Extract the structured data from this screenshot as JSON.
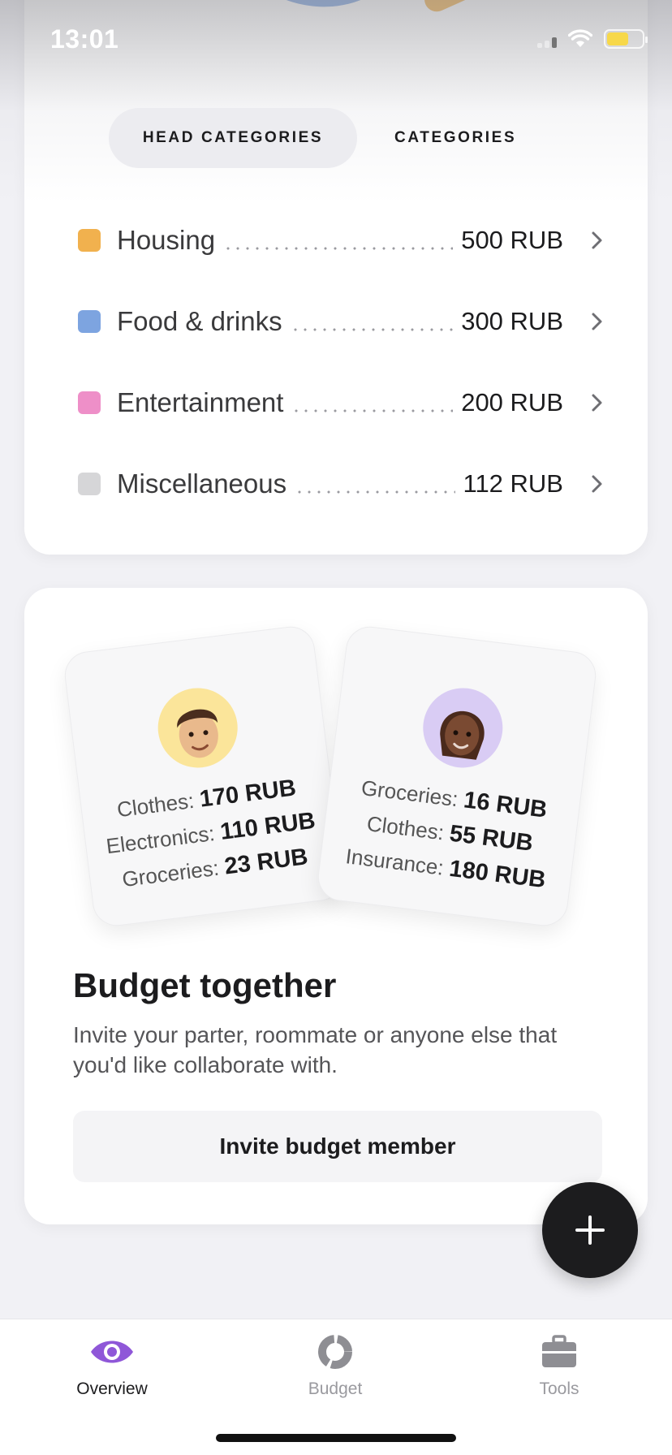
{
  "status_bar": {
    "time": "13:01"
  },
  "segmented": {
    "head_categories": "HEAD CATEGORIES",
    "categories": "CATEGORIES"
  },
  "categories": [
    {
      "name": "Housing",
      "amount": "500 RUB",
      "color": "#f1b14e"
    },
    {
      "name": "Food & drinks",
      "amount": "300 RUB",
      "color": "#7da4e0"
    },
    {
      "name": "Entertainment",
      "amount": "200 RUB",
      "color": "#ee8fc8"
    },
    {
      "name": "Miscellaneous",
      "amount": "112 RUB",
      "color": "#d6d6d8"
    }
  ],
  "budget_together": {
    "member1": {
      "lines": [
        {
          "label": "Clothes:",
          "value": "170 RUB"
        },
        {
          "label": "Electronics:",
          "value": "110 RUB"
        },
        {
          "label": "Groceries:",
          "value": "23 RUB"
        }
      ]
    },
    "member2": {
      "lines": [
        {
          "label": "Groceries:",
          "value": "16 RUB"
        },
        {
          "label": "Clothes:",
          "value": "55 RUB"
        },
        {
          "label": "Insurance:",
          "value": "180 RUB"
        }
      ]
    },
    "title": "Budget together",
    "description": "Invite your parter, roommate or anyone else that you'd like collaborate with.",
    "invite_button": "Invite budget member"
  },
  "tab_bar": {
    "overview": "Overview",
    "budget": "Budget",
    "tools": "Tools",
    "active_color": "#8f57d8"
  }
}
